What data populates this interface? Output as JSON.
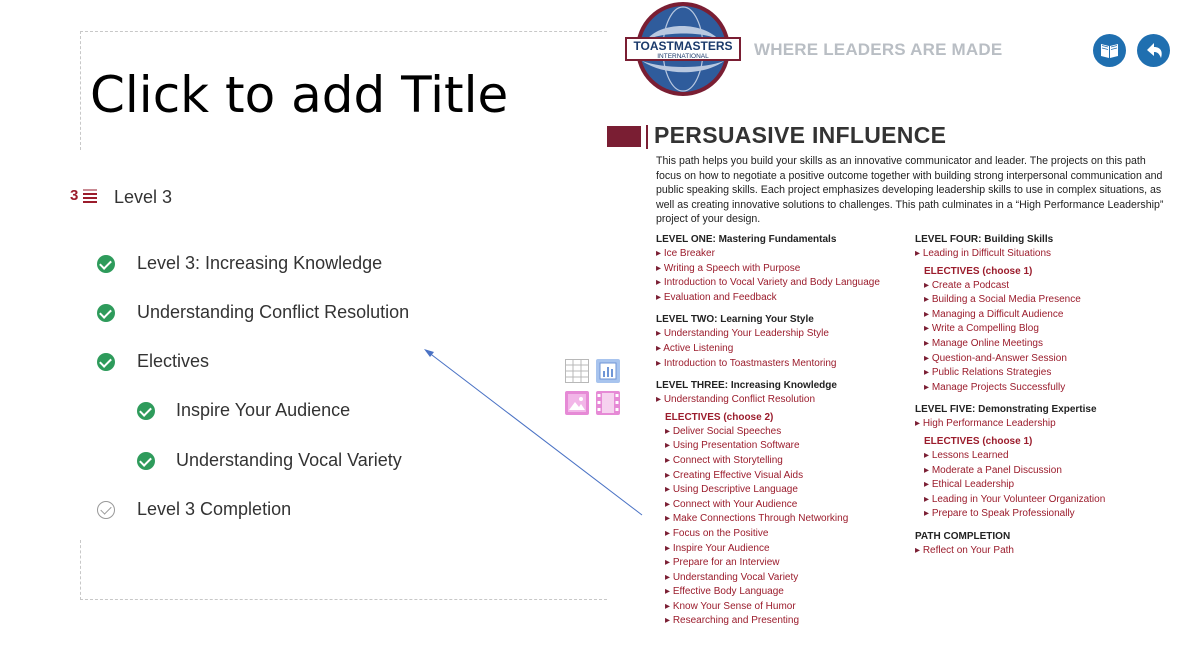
{
  "slide": {
    "title_placeholder": "Click to add Title",
    "level_header": {
      "icon_num": "3",
      "label": "Level 3"
    },
    "items": [
      {
        "label": "Level 3: Increasing Knowledge",
        "status": "complete"
      },
      {
        "label": "Understanding Conflict Resolution",
        "status": "complete"
      },
      {
        "label": "Electives",
        "status": "complete"
      },
      {
        "label": "Inspire Your Audience",
        "status": "complete"
      },
      {
        "label": "Understanding Vocal Variety",
        "status": "complete"
      },
      {
        "label": "Level 3 Completion",
        "status": "pending"
      }
    ],
    "insert_icons": [
      "table-icon",
      "chart-icon",
      "picture-icon",
      "video-icon"
    ]
  },
  "panel": {
    "logo_text": {
      "top": "TOASTMASTERS",
      "bottom": "INTERNATIONAL"
    },
    "tagline": "WHERE LEADERS ARE MADE",
    "buttons": [
      "book-icon",
      "back-arrow-icon"
    ],
    "path_title": "PERSUASIVE INFLUENCE",
    "path_description": "This path helps you build your skills as an innovative communicator and leader. The projects on this path focus on how to negotiate a positive outcome together with building strong interpersonal communication and public speaking skills. Each project emphasizes developing leadership skills to use in complex situations, as well as creating innovative solutions to challenges. This path culminates in a “High Performance Leadership” project of your design.",
    "left_column": {
      "level1": {
        "heading": "LEVEL ONE: Mastering Fundamentals",
        "projects": [
          "Ice Breaker",
          "Writing a Speech with Purpose",
          "Introduction to Vocal Variety and Body Language",
          "Evaluation and Feedback"
        ]
      },
      "level2": {
        "heading": "LEVEL TWO: Learning Your Style",
        "projects": [
          "Understanding Your Leadership Style",
          "Active Listening",
          "Introduction to Toastmasters Mentoring"
        ]
      },
      "level3": {
        "heading": "LEVEL THREE: Increasing Knowledge",
        "projects": [
          "Understanding Conflict Resolution"
        ],
        "electives_heading": "ELECTIVES (choose 2)",
        "electives": [
          "Deliver Social Speeches",
          "Using Presentation Software",
          "Connect with Storytelling",
          "Creating Effective Visual Aids",
          "Using Descriptive Language",
          "Connect with Your Audience",
          "Make Connections Through Networking",
          "Focus on the Positive",
          "Inspire Your Audience",
          "Prepare for an Interview",
          "Understanding Vocal Variety",
          "Effective Body Language",
          "Know Your Sense of Humor",
          "Researching and Presenting"
        ]
      }
    },
    "right_column": {
      "level4": {
        "heading": "LEVEL FOUR: Building Skills",
        "projects": [
          "Leading in Difficult Situations"
        ],
        "electives_heading": "ELECTIVES (choose 1)",
        "electives": [
          "Create a Podcast",
          "Building a Social Media Presence",
          "Managing a Difficult Audience",
          "Write a Compelling Blog",
          "Manage Online Meetings",
          "Question-and-Answer Session",
          "Public Relations Strategies",
          "Manage Projects Successfully"
        ]
      },
      "level5": {
        "heading": "LEVEL FIVE: Demonstrating Expertise",
        "projects": [
          "High Performance Leadership"
        ],
        "electives_heading": "ELECTIVES (choose 1)",
        "electives": [
          "Lessons Learned",
          "Moderate a Panel Discussion",
          "Ethical Leadership",
          "Leading in Your Volunteer Organization",
          "Prepare to Speak Professionally"
        ]
      },
      "completion": {
        "heading": "PATH COMPLETION",
        "projects": [
          "Reflect on Your Path"
        ]
      }
    }
  },
  "colors": {
    "maroon": "#9b1c2c",
    "check_green": "#2e9b5b",
    "blue_button": "#1f6fb0",
    "tagline_gray": "#b9bec4"
  }
}
